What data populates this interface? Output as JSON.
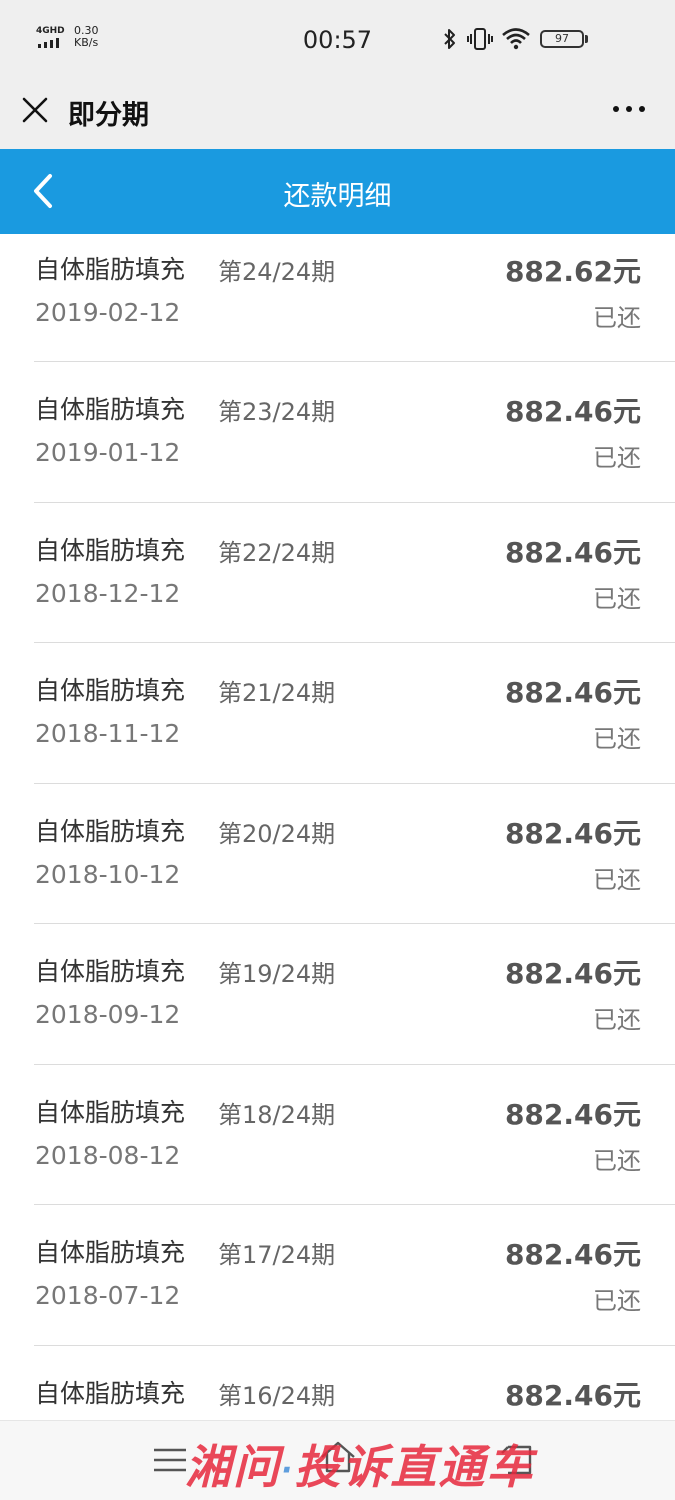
{
  "status_bar": {
    "network": "4GHD",
    "speed_value": "0.30",
    "speed_unit": "KB/s",
    "time": "00:57",
    "battery": "97"
  },
  "app_bar": {
    "title": "即分期"
  },
  "header": {
    "title": "还款明细"
  },
  "payments": [
    {
      "name": "自体脂肪填充",
      "period": "第24/24期",
      "date": "2019-02-12",
      "amount": "882.62元",
      "status": "已还"
    },
    {
      "name": "自体脂肪填充",
      "period": "第23/24期",
      "date": "2019-01-12",
      "amount": "882.46元",
      "status": "已还"
    },
    {
      "name": "自体脂肪填充",
      "period": "第22/24期",
      "date": "2018-12-12",
      "amount": "882.46元",
      "status": "已还"
    },
    {
      "name": "自体脂肪填充",
      "period": "第21/24期",
      "date": "2018-11-12",
      "amount": "882.46元",
      "status": "已还"
    },
    {
      "name": "自体脂肪填充",
      "period": "第20/24期",
      "date": "2018-10-12",
      "amount": "882.46元",
      "status": "已还"
    },
    {
      "name": "自体脂肪填充",
      "period": "第19/24期",
      "date": "2018-09-12",
      "amount": "882.46元",
      "status": "已还"
    },
    {
      "name": "自体脂肪填充",
      "period": "第18/24期",
      "date": "2018-08-12",
      "amount": "882.46元",
      "status": "已还"
    },
    {
      "name": "自体脂肪填充",
      "period": "第17/24期",
      "date": "2018-07-12",
      "amount": "882.46元",
      "status": "已还"
    },
    {
      "name": "自体脂肪填充",
      "period": "第16/24期",
      "date": "",
      "amount": "882.46元",
      "status": ""
    }
  ],
  "watermark": {
    "left": "湘问",
    "middle": "·",
    "right": "投诉直通车"
  },
  "colors": {
    "header_blue": "#1a9ae0",
    "bar_gray": "#efefef",
    "watermark_red": "#e6283c"
  },
  "icons": {
    "close": "close-icon",
    "more": "more-icon",
    "back": "chevron-left-icon",
    "bluetooth": "bluetooth-icon",
    "vibrate": "vibrate-icon",
    "wifi": "wifi-icon",
    "battery": "battery-icon",
    "nav_menu": "menu-icon",
    "nav_home": "home-icon",
    "nav_back": "back-icon"
  }
}
